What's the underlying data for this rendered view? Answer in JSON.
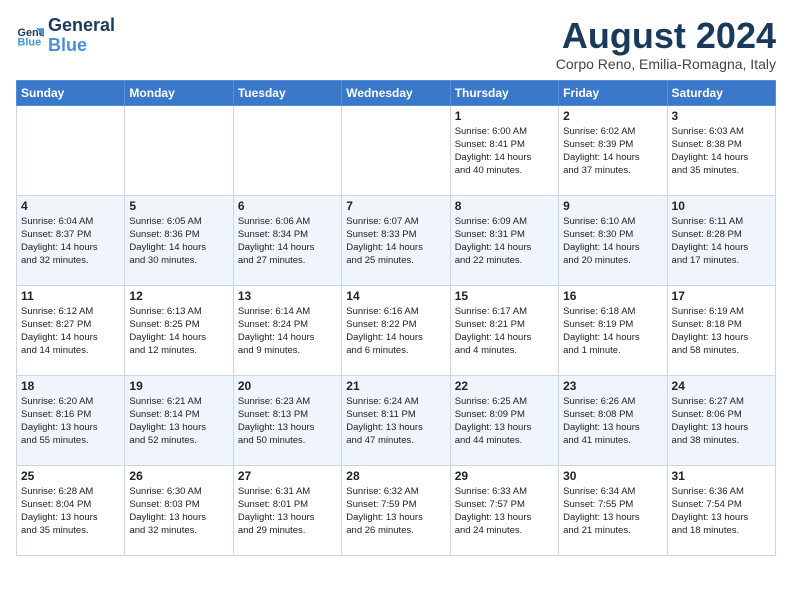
{
  "logo": {
    "line1": "General",
    "line2": "Blue"
  },
  "title": "August 2024",
  "subtitle": "Corpo Reno, Emilia-Romagna, Italy",
  "weekdays": [
    "Sunday",
    "Monday",
    "Tuesday",
    "Wednesday",
    "Thursday",
    "Friday",
    "Saturday"
  ],
  "weeks": [
    [
      {
        "day": "",
        "detail": ""
      },
      {
        "day": "",
        "detail": ""
      },
      {
        "day": "",
        "detail": ""
      },
      {
        "day": "",
        "detail": ""
      },
      {
        "day": "1",
        "detail": "Sunrise: 6:00 AM\nSunset: 8:41 PM\nDaylight: 14 hours\nand 40 minutes."
      },
      {
        "day": "2",
        "detail": "Sunrise: 6:02 AM\nSunset: 8:39 PM\nDaylight: 14 hours\nand 37 minutes."
      },
      {
        "day": "3",
        "detail": "Sunrise: 6:03 AM\nSunset: 8:38 PM\nDaylight: 14 hours\nand 35 minutes."
      }
    ],
    [
      {
        "day": "4",
        "detail": "Sunrise: 6:04 AM\nSunset: 8:37 PM\nDaylight: 14 hours\nand 32 minutes."
      },
      {
        "day": "5",
        "detail": "Sunrise: 6:05 AM\nSunset: 8:36 PM\nDaylight: 14 hours\nand 30 minutes."
      },
      {
        "day": "6",
        "detail": "Sunrise: 6:06 AM\nSunset: 8:34 PM\nDaylight: 14 hours\nand 27 minutes."
      },
      {
        "day": "7",
        "detail": "Sunrise: 6:07 AM\nSunset: 8:33 PM\nDaylight: 14 hours\nand 25 minutes."
      },
      {
        "day": "8",
        "detail": "Sunrise: 6:09 AM\nSunset: 8:31 PM\nDaylight: 14 hours\nand 22 minutes."
      },
      {
        "day": "9",
        "detail": "Sunrise: 6:10 AM\nSunset: 8:30 PM\nDaylight: 14 hours\nand 20 minutes."
      },
      {
        "day": "10",
        "detail": "Sunrise: 6:11 AM\nSunset: 8:28 PM\nDaylight: 14 hours\nand 17 minutes."
      }
    ],
    [
      {
        "day": "11",
        "detail": "Sunrise: 6:12 AM\nSunset: 8:27 PM\nDaylight: 14 hours\nand 14 minutes."
      },
      {
        "day": "12",
        "detail": "Sunrise: 6:13 AM\nSunset: 8:25 PM\nDaylight: 14 hours\nand 12 minutes."
      },
      {
        "day": "13",
        "detail": "Sunrise: 6:14 AM\nSunset: 8:24 PM\nDaylight: 14 hours\nand 9 minutes."
      },
      {
        "day": "14",
        "detail": "Sunrise: 6:16 AM\nSunset: 8:22 PM\nDaylight: 14 hours\nand 6 minutes."
      },
      {
        "day": "15",
        "detail": "Sunrise: 6:17 AM\nSunset: 8:21 PM\nDaylight: 14 hours\nand 4 minutes."
      },
      {
        "day": "16",
        "detail": "Sunrise: 6:18 AM\nSunset: 8:19 PM\nDaylight: 14 hours\nand 1 minute."
      },
      {
        "day": "17",
        "detail": "Sunrise: 6:19 AM\nSunset: 8:18 PM\nDaylight: 13 hours\nand 58 minutes."
      }
    ],
    [
      {
        "day": "18",
        "detail": "Sunrise: 6:20 AM\nSunset: 8:16 PM\nDaylight: 13 hours\nand 55 minutes."
      },
      {
        "day": "19",
        "detail": "Sunrise: 6:21 AM\nSunset: 8:14 PM\nDaylight: 13 hours\nand 52 minutes."
      },
      {
        "day": "20",
        "detail": "Sunrise: 6:23 AM\nSunset: 8:13 PM\nDaylight: 13 hours\nand 50 minutes."
      },
      {
        "day": "21",
        "detail": "Sunrise: 6:24 AM\nSunset: 8:11 PM\nDaylight: 13 hours\nand 47 minutes."
      },
      {
        "day": "22",
        "detail": "Sunrise: 6:25 AM\nSunset: 8:09 PM\nDaylight: 13 hours\nand 44 minutes."
      },
      {
        "day": "23",
        "detail": "Sunrise: 6:26 AM\nSunset: 8:08 PM\nDaylight: 13 hours\nand 41 minutes."
      },
      {
        "day": "24",
        "detail": "Sunrise: 6:27 AM\nSunset: 8:06 PM\nDaylight: 13 hours\nand 38 minutes."
      }
    ],
    [
      {
        "day": "25",
        "detail": "Sunrise: 6:28 AM\nSunset: 8:04 PM\nDaylight: 13 hours\nand 35 minutes."
      },
      {
        "day": "26",
        "detail": "Sunrise: 6:30 AM\nSunset: 8:03 PM\nDaylight: 13 hours\nand 32 minutes."
      },
      {
        "day": "27",
        "detail": "Sunrise: 6:31 AM\nSunset: 8:01 PM\nDaylight: 13 hours\nand 29 minutes."
      },
      {
        "day": "28",
        "detail": "Sunrise: 6:32 AM\nSunset: 7:59 PM\nDaylight: 13 hours\nand 26 minutes."
      },
      {
        "day": "29",
        "detail": "Sunrise: 6:33 AM\nSunset: 7:57 PM\nDaylight: 13 hours\nand 24 minutes."
      },
      {
        "day": "30",
        "detail": "Sunrise: 6:34 AM\nSunset: 7:55 PM\nDaylight: 13 hours\nand 21 minutes."
      },
      {
        "day": "31",
        "detail": "Sunrise: 6:36 AM\nSunset: 7:54 PM\nDaylight: 13 hours\nand 18 minutes."
      }
    ]
  ]
}
